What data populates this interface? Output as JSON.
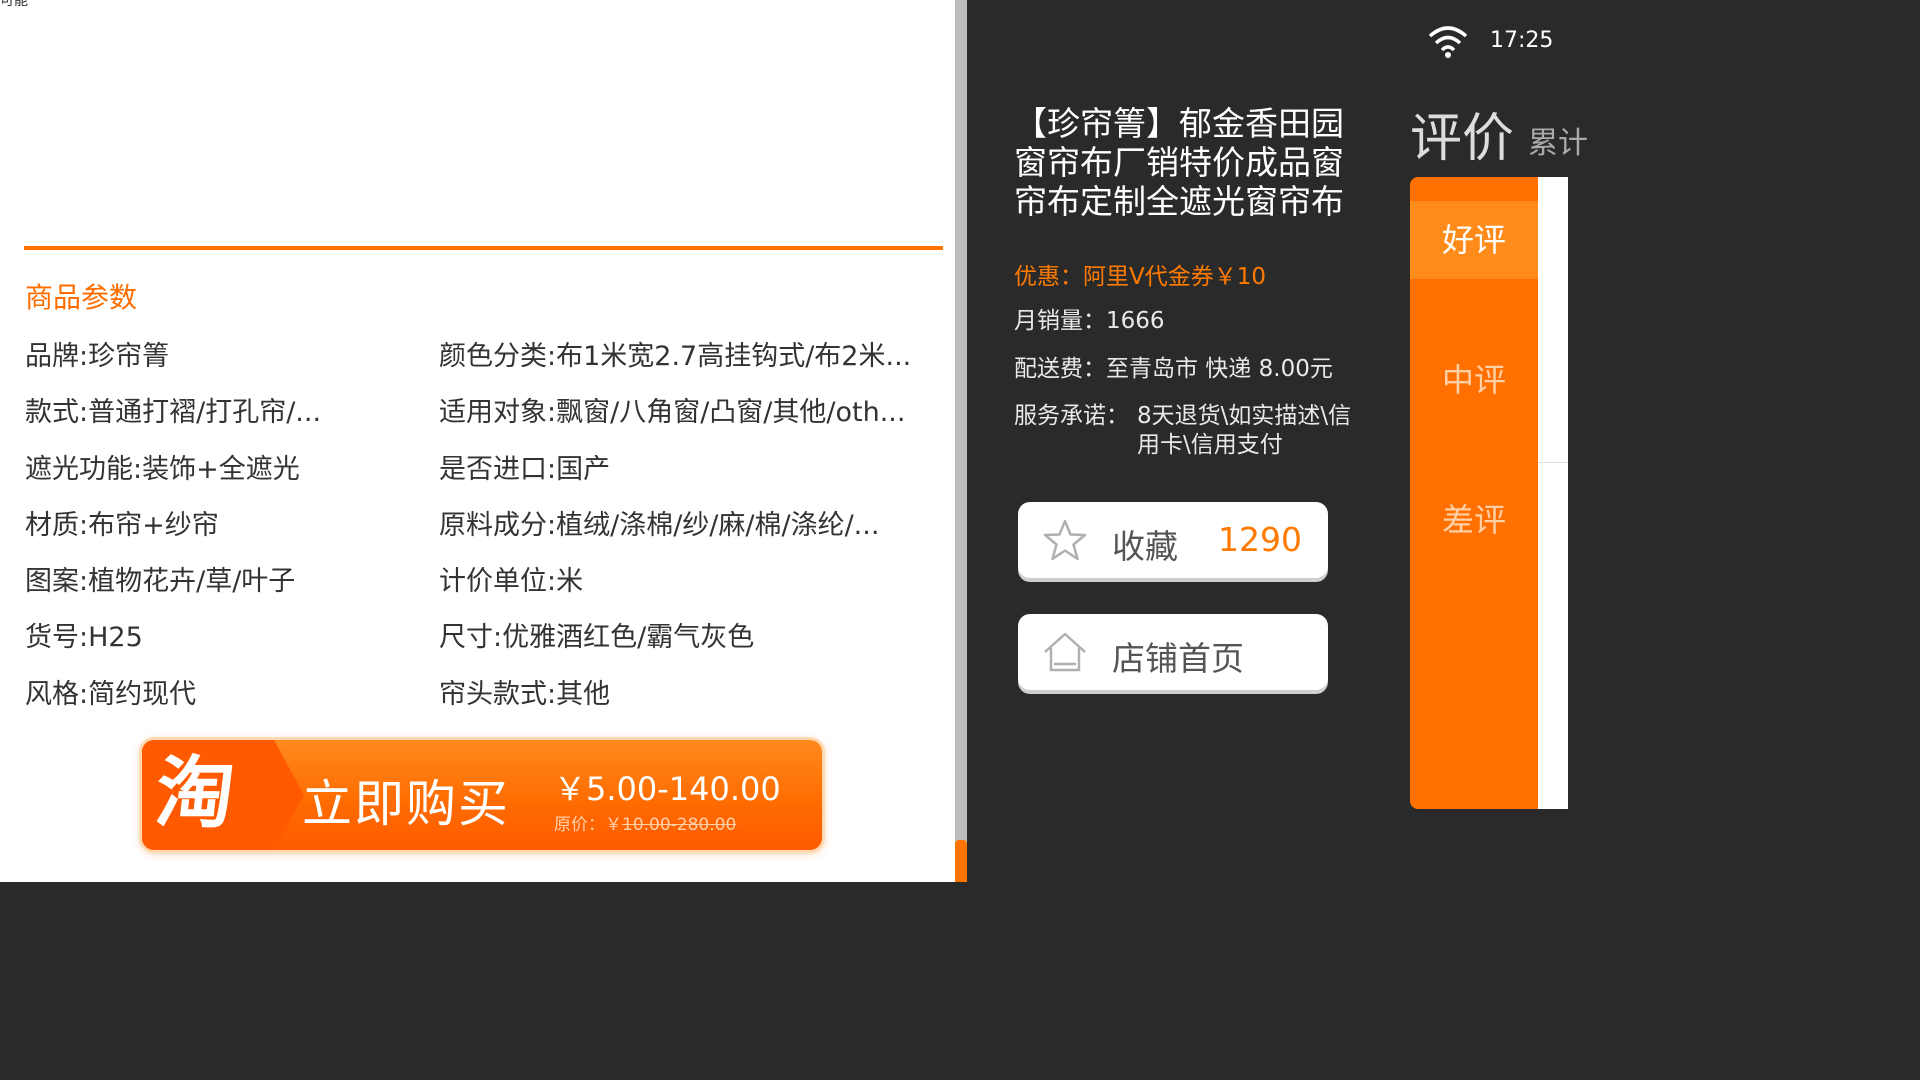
{
  "top_fragment": "可能",
  "params": {
    "title": "商品参数",
    "left": [
      "品牌:珍帘箐",
      "款式:普通打褶/打孔帘/...",
      "遮光功能:装饰+全遮光",
      "材质:布帘+纱帘",
      "图案:植物花卉/草/叶子",
      "货号:H25",
      "风格:简约现代"
    ],
    "right": [
      "颜色分类:布1米宽2.7高挂钩式/布2米...",
      "适用对象:飘窗/八角窗/凸窗/其他/oth...",
      "是否进口:国产",
      "原料成分:植绒/涤棉/纱/麻/棉/涤纶/...",
      "计价单位:米",
      "尺寸:优雅酒红色/霸气灰色",
      "帘头款式:其他"
    ]
  },
  "buy": {
    "logo_char": "淘",
    "label": "立即购买",
    "price": "￥5.00-140.00",
    "original_label": "原价：￥",
    "original_price": "10.00-280.00"
  },
  "status": {
    "time": "17:25"
  },
  "product": {
    "title": "【珍帘箐】郁金香田园窗帘布厂销特价成品窗帘布定制全遮光窗帘布",
    "promo": "优惠：阿里V代金券￥10",
    "monthly_sales": "月销量：1666",
    "shipping": "配送费：至青岛市 快递 8.00元",
    "service_label": "服务承诺：",
    "service_text": "8天退货\\如实描述\\信用卡\\信用支付"
  },
  "actions": {
    "favorite_label": "收藏",
    "favorite_count": "1290",
    "store_label": "店铺首页"
  },
  "reviews": {
    "heading": "评价",
    "sub": "累计",
    "tabs": [
      "好评",
      "中评",
      "差评"
    ]
  },
  "colors": {
    "accent": "#ff7300",
    "dark_bg": "#2a2a2a",
    "button_bg": "#ffffff"
  },
  "icons": [
    "wifi-icon",
    "star-icon",
    "home-icon"
  ]
}
